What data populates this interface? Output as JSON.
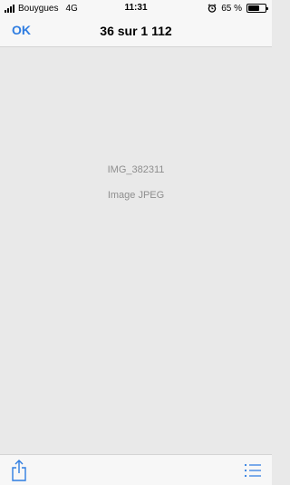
{
  "status_bar": {
    "carrier": "Bouygues",
    "network": "4G",
    "time": "11:31",
    "alarm_icon": "alarm-clock-icon",
    "battery_percent_label": "65 %",
    "battery_level": 0.65
  },
  "nav": {
    "done_label": "OK",
    "title": "36 sur 1 112"
  },
  "content": {
    "file_name": "IMG_382311",
    "file_type": "Image JPEG"
  },
  "toolbar": {
    "share_icon": "share-icon",
    "list_icon": "list-icon"
  },
  "colors": {
    "accent": "#2f7de1",
    "background": "#e9e9e9",
    "bar": "#f7f7f7",
    "secondary_text": "#8e8e8e"
  }
}
